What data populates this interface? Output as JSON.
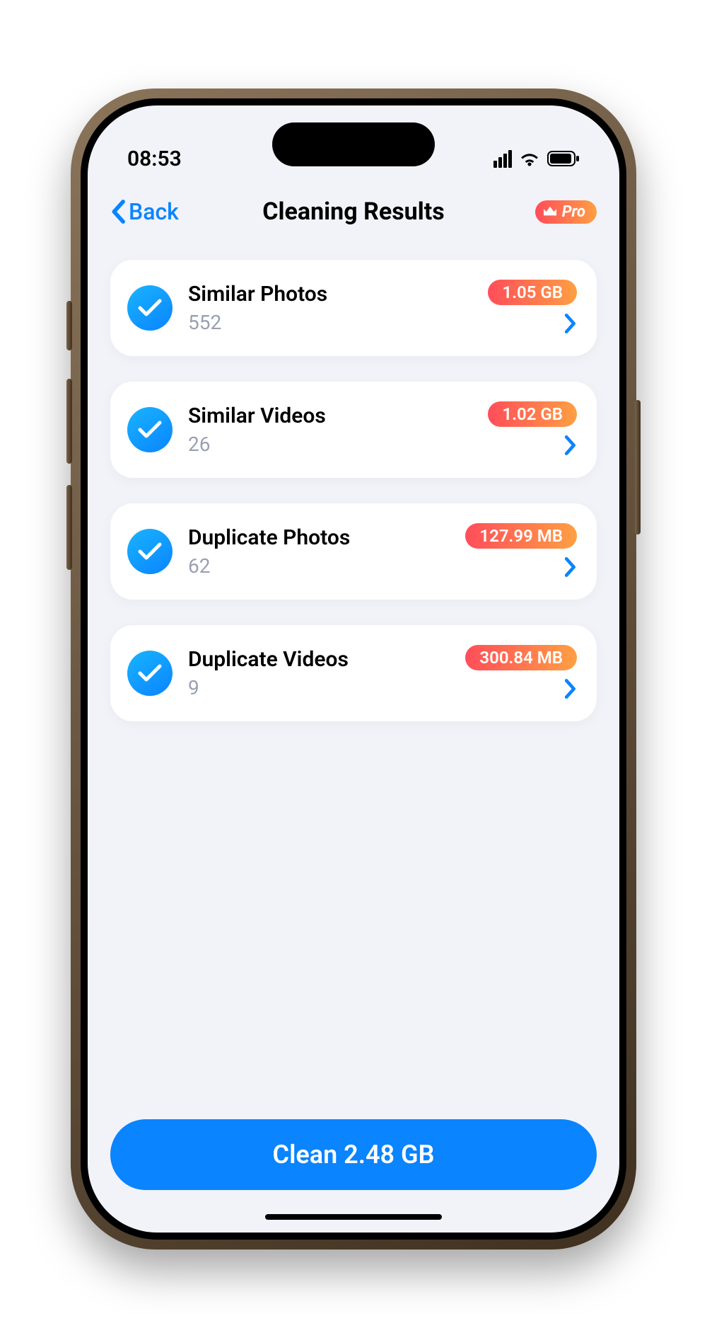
{
  "status": {
    "time": "08:53"
  },
  "nav": {
    "back_label": "Back",
    "title": "Cleaning Results",
    "pro_label": "Pro"
  },
  "items": [
    {
      "title": "Similar Photos",
      "count": "552",
      "size": "1.05 GB"
    },
    {
      "title": "Similar Videos",
      "count": "26",
      "size": "1.02 GB"
    },
    {
      "title": "Duplicate Photos",
      "count": "62",
      "size": "127.99 MB"
    },
    {
      "title": "Duplicate Videos",
      "count": "9",
      "size": "300.84 MB"
    }
  ],
  "footer": {
    "clean_label": "Clean 2.48 GB"
  }
}
